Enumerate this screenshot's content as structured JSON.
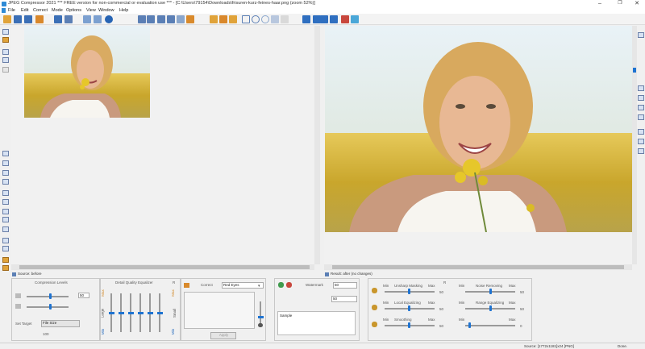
{
  "window": {
    "title": "JPEG Compressor 2021     *** FREE version for non-commercial or evaluation use ***  - [C:\\Users\\79154\\Downloads\\frisuren-kurz-feines-haar.png   (zoom 52%)]",
    "minimize": "–",
    "maximize": "❐",
    "close": "✕"
  },
  "menu": [
    "File",
    "Edit",
    "Correct",
    "Mode",
    "Options",
    "View",
    "Window",
    "Help"
  ],
  "panes": {
    "source_label": "Source: before",
    "result_label": "Result: after (no changes)"
  },
  "compression": {
    "title": "Compression Levels",
    "value": "50",
    "set_target_label": "Set Target",
    "file_size_button": "File Size",
    "target_value": "100"
  },
  "equalizer": {
    "title": "Detail Quality Equalizer",
    "r_label": "R",
    "left_label": "Large",
    "right_label": "Small",
    "top_labels": [
      "Max",
      "Max"
    ],
    "bottom_labels": [
      "Min",
      "Min"
    ],
    "levels": [
      0.5,
      0.5,
      0.5,
      0.5,
      0.5,
      0.5
    ]
  },
  "correct": {
    "label": "Correct",
    "select_value": "Red Eyes",
    "apply_button": "Apply"
  },
  "watermark": {
    "label": "Watermark",
    "size_value": "50",
    "second_value": "50",
    "text": "Sample"
  },
  "adjust": {
    "r_label": "R",
    "rows": [
      {
        "left_title": "Unsharp Masking",
        "left_value": "50",
        "right_title": "Noise Removing",
        "right_value": "50"
      },
      {
        "left_title": "Local Equalizing",
        "left_value": "50",
        "right_title": "Range Equalizing",
        "right_value": "50"
      },
      {
        "left_title": "Smoothing",
        "left_value": "50",
        "right_title": "",
        "right_value": "0"
      }
    ],
    "min_label": "Min",
    "max_label": "Max"
  },
  "status": {
    "info": "Source: [1772x1181]x24 [PNG]",
    "state": "Done."
  },
  "colors": {
    "accent": "#1e73d1",
    "toolbar_icon": "#5b7fb5"
  }
}
